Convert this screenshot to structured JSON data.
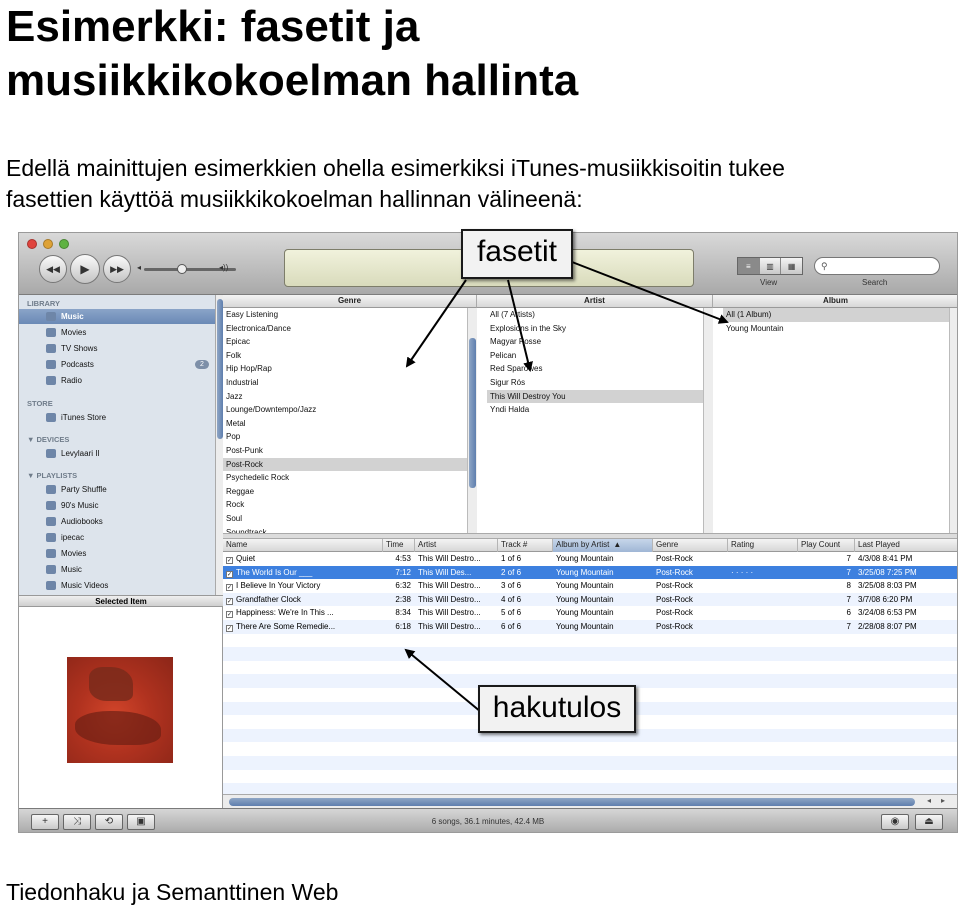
{
  "slide": {
    "title_line1": "Esimerkki: fasetit ja",
    "title_line2": "musiikkikokoelman hallinta",
    "body_line1": "Edellä mainittujen esimerkkien ohella esimerkiksi iTunes-musiikkisoitin tukee",
    "body_line2": "fasettien käyttöä musiikkikokoelman hallinnan välineenä:",
    "footer": "Tiedonhaku ja Semanttinen Web"
  },
  "annotations": {
    "facets_label": "fasetit",
    "results_label": "hakutulos"
  },
  "window": {
    "traffic_colors": [
      "#e0443e",
      "#dea236",
      "#5fb242"
    ],
    "toolbar": {
      "prev_icon": "◀◀",
      "play_icon": "▶",
      "next_icon": "▶▶",
      "vol_low_icon": "◂",
      "vol_high_icon": "◂))",
      "view_label": "View",
      "search_label": "Search",
      "search_icon": "⚲",
      "view_icons": [
        "≡",
        "▥",
        "▦"
      ]
    },
    "sidebar": {
      "library_header": "LIBRARY",
      "library": [
        {
          "label": "Music",
          "selected": true
        },
        {
          "label": "Movies"
        },
        {
          "label": "TV Shows"
        },
        {
          "label": "Podcasts",
          "badge": "2"
        },
        {
          "label": "Radio"
        }
      ],
      "store_header": "STORE",
      "store": [
        {
          "label": "iTunes Store"
        }
      ],
      "devices_header": "▼ DEVICES",
      "devices": [
        {
          "label": "Levylaari II"
        }
      ],
      "playlists_header": "▼ PLAYLISTS",
      "playlists": [
        {
          "label": "Party Shuffle"
        },
        {
          "label": "90's Music"
        },
        {
          "label": "Audiobooks"
        },
        {
          "label": "ipecac"
        },
        {
          "label": "Movies"
        },
        {
          "label": "Music"
        },
        {
          "label": "Music Videos"
        }
      ],
      "selected_item_label": "Selected Item"
    },
    "browser": {
      "genre_header": "Genre",
      "artist_header": "Artist",
      "album_header": "Album",
      "genres": [
        "Easy Listening",
        "Electronica/Dance",
        "Epicac",
        "Folk",
        "Hip Hop/Rap",
        "Industrial",
        "Jazz",
        "Lounge/Downtempo/Jazz",
        "Metal",
        "Pop",
        "Post-Punk",
        "Post-Rock",
        "Psychedelic Rock",
        "Reggae",
        "Rock",
        "Soul",
        "Soundtrack"
      ],
      "genre_selected": "Post-Rock",
      "artists": [
        "All (7 Artists)",
        "Explosions in the Sky",
        "Magyar Posse",
        "Pelican",
        "Red Sparowes",
        "Sigur Rós",
        "This Will Destroy You",
        "Yndi Halda"
      ],
      "artist_selected": "This Will Destroy You",
      "albums": [
        "All (1 Album)",
        "Young Mountain"
      ],
      "album_selected": "All (1 Album)"
    },
    "tracks": {
      "columns": [
        "Name",
        "Time",
        "Artist",
        "Track #",
        "Album by Artist",
        "Genre",
        "Rating",
        "Play Count",
        "Last Played"
      ],
      "sort_indicator": "▲",
      "rows": [
        {
          "name": "Quiet",
          "time": "4:53",
          "artist": "This Will Destro...",
          "track": "1 of 6",
          "album": "Young Mountain",
          "genre": "Post-Rock",
          "rating": "",
          "plays": "7",
          "last": "4/3/08 8:41 PM"
        },
        {
          "name": "The World Is Our ___",
          "time": "7:12",
          "artist": "This Will Des...",
          "track": "2 of 6",
          "album": "Young Mountain",
          "genre": "Post-Rock",
          "rating": "· · · · ·",
          "plays": "7",
          "last": "3/25/08 7:25 PM",
          "selected": true
        },
        {
          "name": "I Believe In Your Victory",
          "time": "6:32",
          "artist": "This Will Destro...",
          "track": "3 of 6",
          "album": "Young Mountain",
          "genre": "Post-Rock",
          "rating": "",
          "plays": "8",
          "last": "3/25/08 8:03 PM"
        },
        {
          "name": "Grandfather Clock",
          "time": "2:38",
          "artist": "This Will Destro...",
          "track": "4 of 6",
          "album": "Young Mountain",
          "genre": "Post-Rock",
          "rating": "",
          "plays": "7",
          "last": "3/7/08 6:20 PM"
        },
        {
          "name": "Happiness: We're In This ...",
          "time": "8:34",
          "artist": "This Will Destro...",
          "track": "5 of 6",
          "album": "Young Mountain",
          "genre": "Post-Rock",
          "rating": "",
          "plays": "6",
          "last": "3/24/08 6:53 PM"
        },
        {
          "name": "There Are Some Remedie...",
          "time": "6:18",
          "artist": "This Will Destro...",
          "track": "6 of 6",
          "album": "Young Mountain",
          "genre": "Post-Rock",
          "rating": "",
          "plays": "7",
          "last": "2/28/08 8:07 PM"
        }
      ]
    },
    "status_text": "6 songs, 36.1 minutes, 42.4 MB",
    "bottom_buttons": [
      "+",
      "⤨",
      "⟲",
      "▣"
    ],
    "right_buttons": [
      "◉",
      "⏏"
    ]
  }
}
